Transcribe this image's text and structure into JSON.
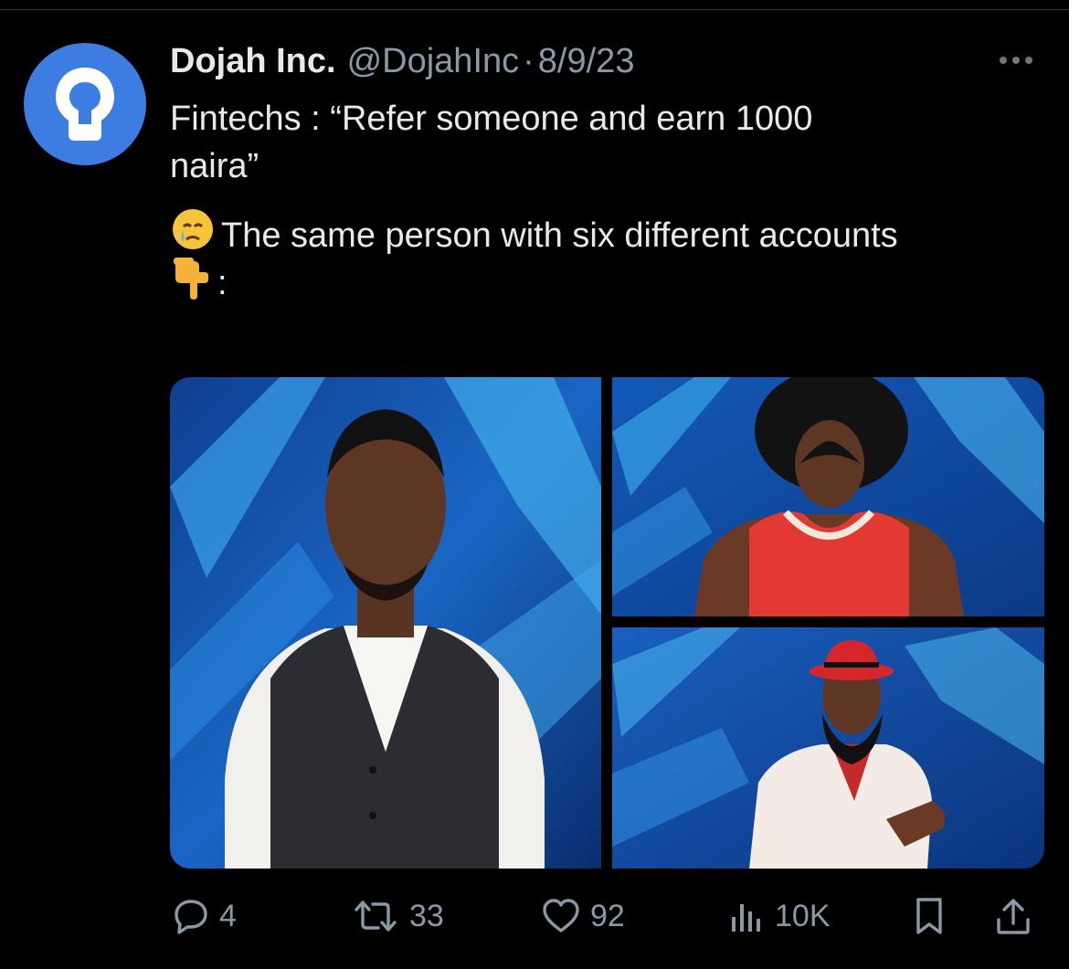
{
  "tweet": {
    "author": {
      "display_name": "Dojah Inc.",
      "handle": "@DojahInc",
      "separator": "·",
      "date": "8/9/23",
      "avatar_icon": "lightbulb-icon",
      "avatar_color": "#3d7ce0"
    },
    "text": {
      "line1": "Fintechs : “Refer someone and earn 1000",
      "line2": "naira”",
      "line3": "The same person with six different accounts",
      "line4": ":",
      "emoji1": "face-holding-back-tears",
      "emoji2": "backhand-index-pointing-down"
    },
    "media": [
      {
        "name": "man-in-striped-vest"
      },
      {
        "name": "man-with-afro-red-jersey"
      },
      {
        "name": "man-with-red-hat-and-beard"
      }
    ],
    "actions": {
      "replies": "4",
      "retweets": "33",
      "likes": "92",
      "views": "10K"
    }
  },
  "colors": {
    "background": "#000000",
    "text": "#e7e9ea",
    "secondary": "#8b98a5"
  }
}
